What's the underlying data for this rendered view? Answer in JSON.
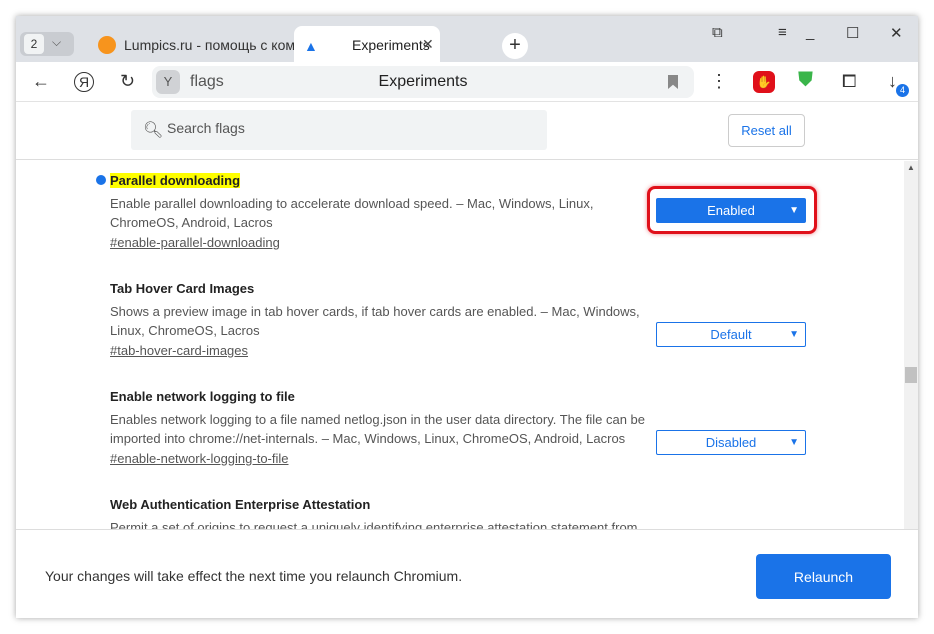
{
  "tabs": {
    "count": "2",
    "items": [
      {
        "title": "Lumpics.ru - помощь с компьютером",
        "icon": "orange-icon"
      },
      {
        "title": "Experiments",
        "icon": "flask-icon",
        "active": true
      }
    ]
  },
  "omnibox": {
    "value": "flags",
    "title": "Experiments"
  },
  "downloads_badge": "4",
  "search": {
    "placeholder": "Search flags"
  },
  "reset_label": "Reset all",
  "flags": [
    {
      "title": "Parallel downloading",
      "desc": "Enable parallel downloading to accelerate download speed. – Mac, Windows, Linux, ChromeOS, Android, Lacros",
      "link": "#enable-parallel-downloading",
      "value": "Enabled",
      "highlighted": true
    },
    {
      "title": "Tab Hover Card Images",
      "desc": "Shows a preview image in tab hover cards, if tab hover cards are enabled. – Mac, Windows, Linux, ChromeOS, Lacros",
      "link": "#tab-hover-card-images",
      "value": "Default"
    },
    {
      "title": "Enable network logging to file",
      "desc": "Enables network logging to a file named netlog.json in the user data directory. The file can be imported into chrome://net-internals. – Mac, Windows, Linux, ChromeOS, Android, Lacros",
      "link": "#enable-network-logging-to-file",
      "value": "Disabled"
    },
    {
      "title": "Web Authentication Enterprise Attestation",
      "desc": "Permit a set of origins to request a uniquely identifying enterprise attestation statement from"
    }
  ],
  "footer": {
    "message": "Your changes will take effect the next time you relaunch Chromium.",
    "relaunch_label": "Relaunch"
  },
  "colors": {
    "accent": "#1a73e8",
    "highlight": "#ffff00",
    "annotation": "#e0101a"
  }
}
